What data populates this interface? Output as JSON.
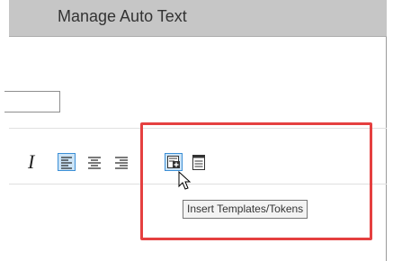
{
  "dialog": {
    "title": "Manage Auto Text"
  },
  "toolbar": {
    "italic_glyph": "I",
    "buttons": [
      {
        "icon": "align-left-icon",
        "state": "active"
      },
      {
        "icon": "align-center-icon",
        "state": "normal"
      },
      {
        "icon": "align-right-icon",
        "state": "normal"
      },
      {
        "icon": "insert-templates-tokens-icon",
        "state": "hover"
      },
      {
        "icon": "document-icon",
        "state": "normal"
      }
    ],
    "tooltip": "Insert Templates/Tokens"
  },
  "colors": {
    "titlebar": "#c6c6c6",
    "highlight": "#e54040",
    "active_button": "#cce4f7",
    "active_border": "#3c8fd6"
  }
}
